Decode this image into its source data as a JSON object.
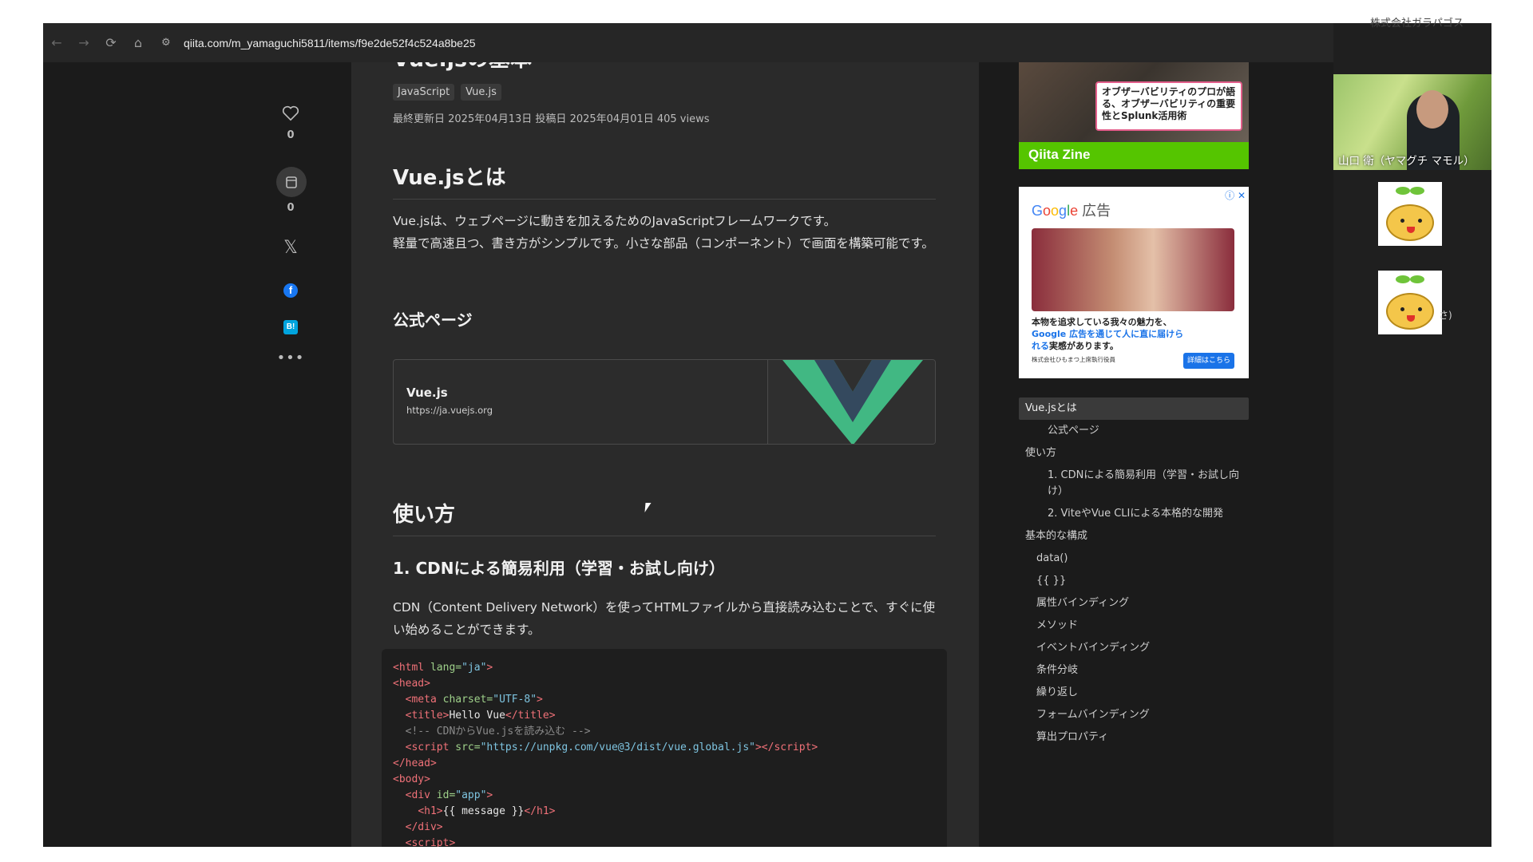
{
  "browser": {
    "url": "qiita.com/m_yamaguchi5811/items/f9e2de52f4c524a8be25"
  },
  "social": {
    "like_count": "0",
    "stock_count": "0"
  },
  "article": {
    "title": "Vue.jsの基本",
    "tags": [
      "JavaScript",
      "Vue.js"
    ],
    "meta": "最終更新日 2025年04月13日  投稿日 2025年04月01日  405 views",
    "section1_heading": "Vue.jsとは",
    "section1_p1": "Vue.jsは、ウェブページに動きを加えるためのJavaScriptフレームワークです。",
    "section1_p2": "軽量で高速且つ、書き方がシンプルです。小さな部品（コンポーネント）で画面を構築可能です。",
    "official_heading": "公式ページ",
    "linkcard_title": "Vue.js",
    "linkcard_url": "https://ja.vuejs.org",
    "section2_heading": "使い方",
    "cdn_heading": "1. CDNによる簡易利用（学習・お試し向け）",
    "cdn_para": "CDN（Content Delivery Network）を使ってHTMLファイルから直接読み込むことで、すぐに使い始めることができます。"
  },
  "ads": {
    "ad1_text": "オブザーバビリティのプロが語る、オブザーバビリティの重要性とSplunk活用術",
    "ad1_bar": "Qiita Zine",
    "ad2_head": "Google 広告",
    "ad2_line1": "本物を追求している我々の魅力を、",
    "ad2_line2": "Google 広告を通じて人に直に届けられる",
    "ad2_line3": "実感があります。",
    "ad2_small": "株式会社ひもまつ上席執行役員",
    "ad2_button": "詳細はこちら"
  },
  "toc": [
    {
      "label": "Vue.jsとは"
    },
    {
      "label": "公式ページ"
    },
    {
      "label": "使い方"
    },
    {
      "label": "1. CDNによる簡易利用（学習・お試し向け）"
    },
    {
      "label": "2. ViteやVue CLIによる本格的な開発"
    },
    {
      "label": "基本的な構成"
    },
    {
      "label": "data()"
    },
    {
      "label": "{{ }}"
    },
    {
      "label": "属性バインディング"
    },
    {
      "label": "メソッド"
    },
    {
      "label": "イベントバインディング"
    },
    {
      "label": "条件分岐"
    },
    {
      "label": "繰り返し"
    },
    {
      "label": "フォームバインディング"
    },
    {
      "label": "算出プロパティ"
    }
  ],
  "video": {
    "participant_name": "山口 衛（ヤマグチ マモル）",
    "company": "株式会社ガラパゴス",
    "partial_label": "さ)"
  }
}
